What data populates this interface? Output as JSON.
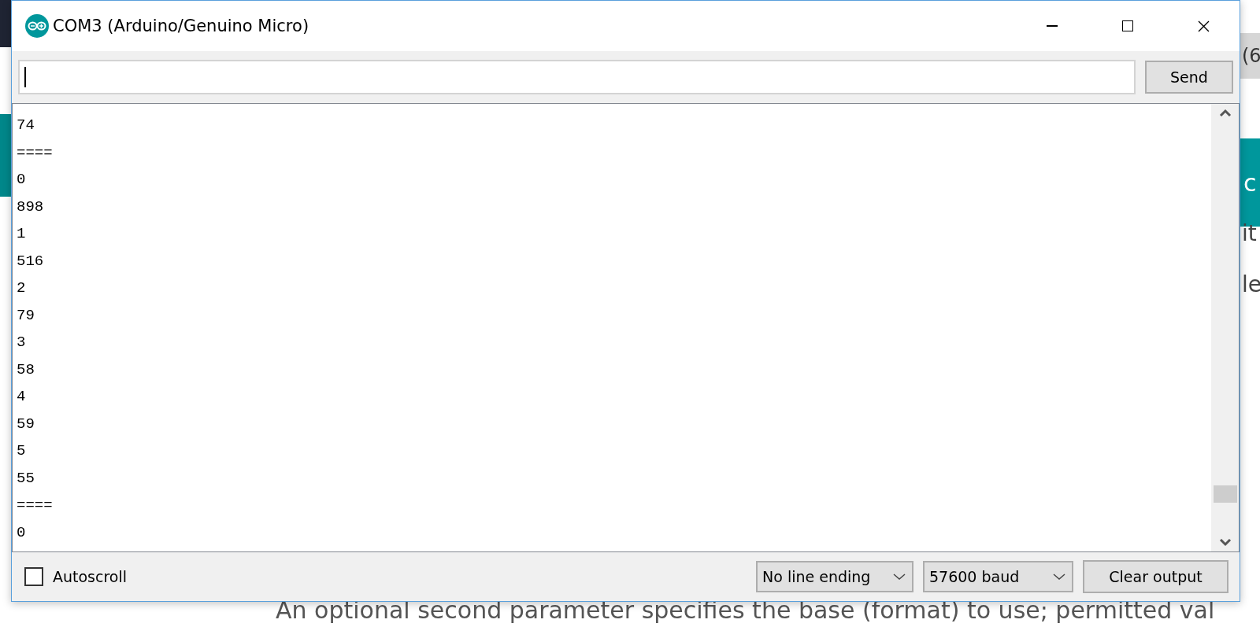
{
  "background_page": {
    "tab_fragment": "(6",
    "banner_fragment": "c",
    "text_fragments": [
      "it",
      "le"
    ],
    "bottom_text": "An optional second parameter specifies the base (format) to use; permitted val"
  },
  "window": {
    "title": "COM3 (Arduino/Genuino Micro)"
  },
  "send_field": {
    "focused": true
  },
  "send_button": "Send",
  "output_lines": [
    "74",
    "====",
    "0",
    "898",
    "1",
    "516",
    "2",
    "79",
    "3",
    "58",
    "4",
    "59",
    "5",
    "55",
    "====",
    "0"
  ],
  "autoscroll": {
    "label": "Autoscroll",
    "checked": false
  },
  "line_ending": "No line ending",
  "baud_rate": "57600 baud",
  "clear_button": "Clear output"
}
